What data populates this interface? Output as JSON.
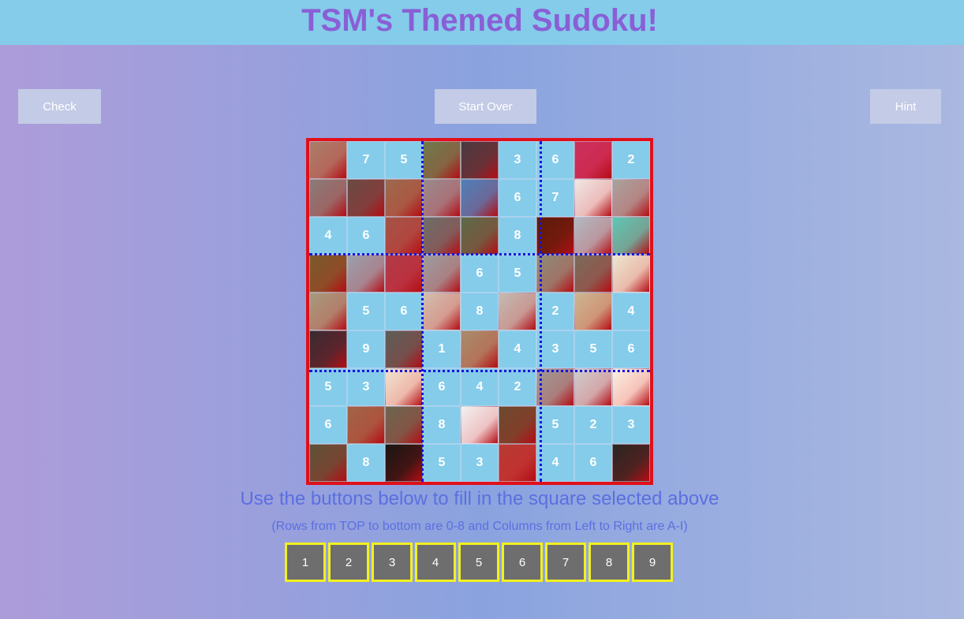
{
  "header": {
    "title": "TSM's Themed Sudoku!"
  },
  "buttons": {
    "check": "Check",
    "start_over": "Start Over",
    "hint": "Hint"
  },
  "board": {
    "rows": [
      [
        "",
        "7",
        "5",
        "",
        "",
        "3",
        "6",
        "",
        "2"
      ],
      [
        "",
        "",
        "",
        "",
        "",
        "6",
        "7",
        "",
        ""
      ],
      [
        "4",
        "6",
        "",
        "",
        "",
        "8",
        "",
        "",
        ""
      ],
      [
        "",
        "",
        "",
        "",
        "6",
        "5",
        "",
        "",
        ""
      ],
      [
        "",
        "5",
        "6",
        "",
        "8",
        "",
        "2",
        "",
        "4"
      ],
      [
        "",
        "9",
        "",
        "1",
        "",
        "4",
        "3",
        "5",
        "6"
      ],
      [
        "5",
        "3",
        "",
        "6",
        "4",
        "2",
        "",
        "",
        ""
      ],
      [
        "6",
        "",
        "",
        "8",
        "",
        "",
        "5",
        "2",
        "3"
      ],
      [
        "",
        "8",
        "",
        "5",
        "3",
        "",
        "4",
        "6",
        ""
      ]
    ],
    "photo_colors": [
      [
        "#a97d6a",
        null,
        null,
        "#6e7a4d",
        "#4a3a3f",
        null,
        null,
        "#c9315e",
        null
      ],
      [
        "#8a7b78",
        "#6a4a44",
        "#9c6a4d",
        "#9a8a8e",
        "#4e7fb8",
        null,
        null,
        "#efe7e3",
        "#a9a29e"
      ],
      [
        null,
        null,
        "#a55347",
        "#6c6e6a",
        "#5c6a48",
        null,
        "#5a1c0a",
        "#b2b8c0",
        "#5cc7b2"
      ],
      [
        "#7a5a2a",
        "#9aa0ac",
        "#b13a48",
        "#9c9c9e",
        null,
        null,
        "#8e8c79",
        "#7a6a5a",
        "#ece6d0"
      ],
      [
        "#a79a7e",
        null,
        null,
        "#d2beae",
        null,
        "#c3bab2",
        null,
        "#cbb690",
        null
      ],
      [
        "#3a2a30",
        null,
        "#5c5e58",
        null,
        "#a88c6a",
        null,
        null,
        null,
        null
      ],
      [
        null,
        null,
        "#f1e3cf",
        null,
        null,
        null,
        "#9d9a96",
        "#cfcdcd",
        "#fbf0e2"
      ],
      [
        null,
        "#a06447",
        "#6c6550",
        null,
        "#f2f0ef",
        "#6b4a2e",
        null,
        null,
        null
      ],
      [
        "#5e5238",
        null,
        "#1a1612",
        null,
        null,
        "#b83a34",
        null,
        null,
        "#2a2622"
      ]
    ]
  },
  "instructions": {
    "main": "Use the buttons below to fill in the square selected above",
    "sub": "(Rows from TOP to bottom are 0-8 and Columns from Left to Right are A-I)"
  },
  "keypad": [
    "1",
    "2",
    "3",
    "4",
    "5",
    "6",
    "7",
    "8",
    "9"
  ],
  "colors": {
    "header_bg": "#84ccea",
    "title": "#8a5fd6",
    "number_cell": "#84ccea",
    "board_border": "#e0101a",
    "box_separator": "#1515e0",
    "key_border": "#f2f020",
    "key_bg": "#6e6e6e",
    "instruction_text": "#5b6fe0"
  }
}
